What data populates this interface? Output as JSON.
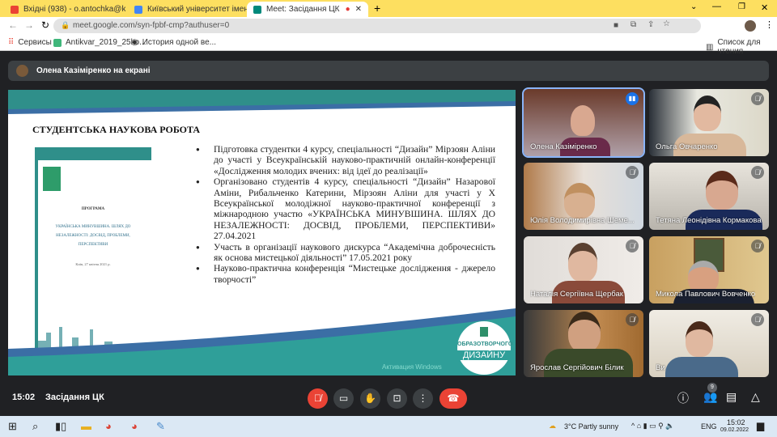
{
  "browser": {
    "tabs": [
      {
        "label": "Вхідні (938) - o.antochka@kubg...",
        "icon": "gmail-icon"
      },
      {
        "label": "Київський університет імені Бор",
        "icon": "university-icon"
      },
      {
        "label": "Meet: Засідання ЦК",
        "icon": "meet-icon"
      }
    ],
    "url": "meet.google.com/syn-fpbf-cmp?authuser=0",
    "bookmarks": [
      "Сервисы",
      "Antikvar_2019_25ko...",
      "История одной ве..."
    ],
    "reading_list": "Список для чтения"
  },
  "meet": {
    "presenter_banner": "Олена Казіміренко на екрані",
    "slide": {
      "title": "СТУДЕНТСЬКА НАУКОВА РОБОТА",
      "bullets": [
        "Підготовка студентки 4 курсу, спеціальності “Дизайн” Мірзоян Аліни до участі у Всеукраїнській науково-практичній онлайн-конференції «Дослідження молодих вчених: від ідеї до реалізації»",
        "Організовано студентів 4 курсу, спеціальності “Дизайн” Назарової Аміни, Рибальченко Катерини, Мірзоян Аліни для участі у Х Всеукраїнської молодіжної науково-практичної конференції з міжнародною участю «УКРАЇНСЬКА МИНУВШИНА. ШЛЯХ ДО НЕЗАЛЕЖНОСТІ: ДОСВІД, ПРОБЛЕМИ, ПЕРСПЕКТИВИ» 27.04.2021",
        "Участь в організації наукового дискурса “Академічна доброчесність як основа мистецької діяльності” 17.05.2021 року",
        "Науково-практична конференція “Мистецьке дослідження - джерело творчості”"
      ],
      "doc_heading": "ПРОГРАМА",
      "doc_title": "УКРАЇНСЬКА МИНУВШИНА. ШЛЯХ ДО НЕЗАЛЕЖНОСТІ: ДОСВІД, ПРОБЛЕМИ, ПЕРСПЕКТИВИ",
      "doc_date": "Київ, 27 квітня 2021 р.",
      "logo_line1": "ОБРАЗОТВОРЧОГО",
      "logo_line2": "ДИЗАЙНУ",
      "watermark": "Активация Windows"
    },
    "participants": [
      {
        "name": "Олена Казіміренко",
        "speaking": true
      },
      {
        "name": "Ольга Овчаренко"
      },
      {
        "name": "Юлія Володимирівна Шеме..."
      },
      {
        "name": "Тетяна Леонідівна Кормакова"
      },
      {
        "name": "Наталія Сергіївна Щербак"
      },
      {
        "name": "Микола Павлович Вовченко"
      },
      {
        "name": "Ярослав Сергійович Білик"
      },
      {
        "name": "Ви"
      }
    ],
    "time": "15:02",
    "meeting_name": "Засідання ЦК",
    "participant_count": "9"
  },
  "taskbar": {
    "weather": "3°C  Partly sunny",
    "lang": "ENG",
    "clock": "15:02",
    "date": "09.02.2022"
  }
}
